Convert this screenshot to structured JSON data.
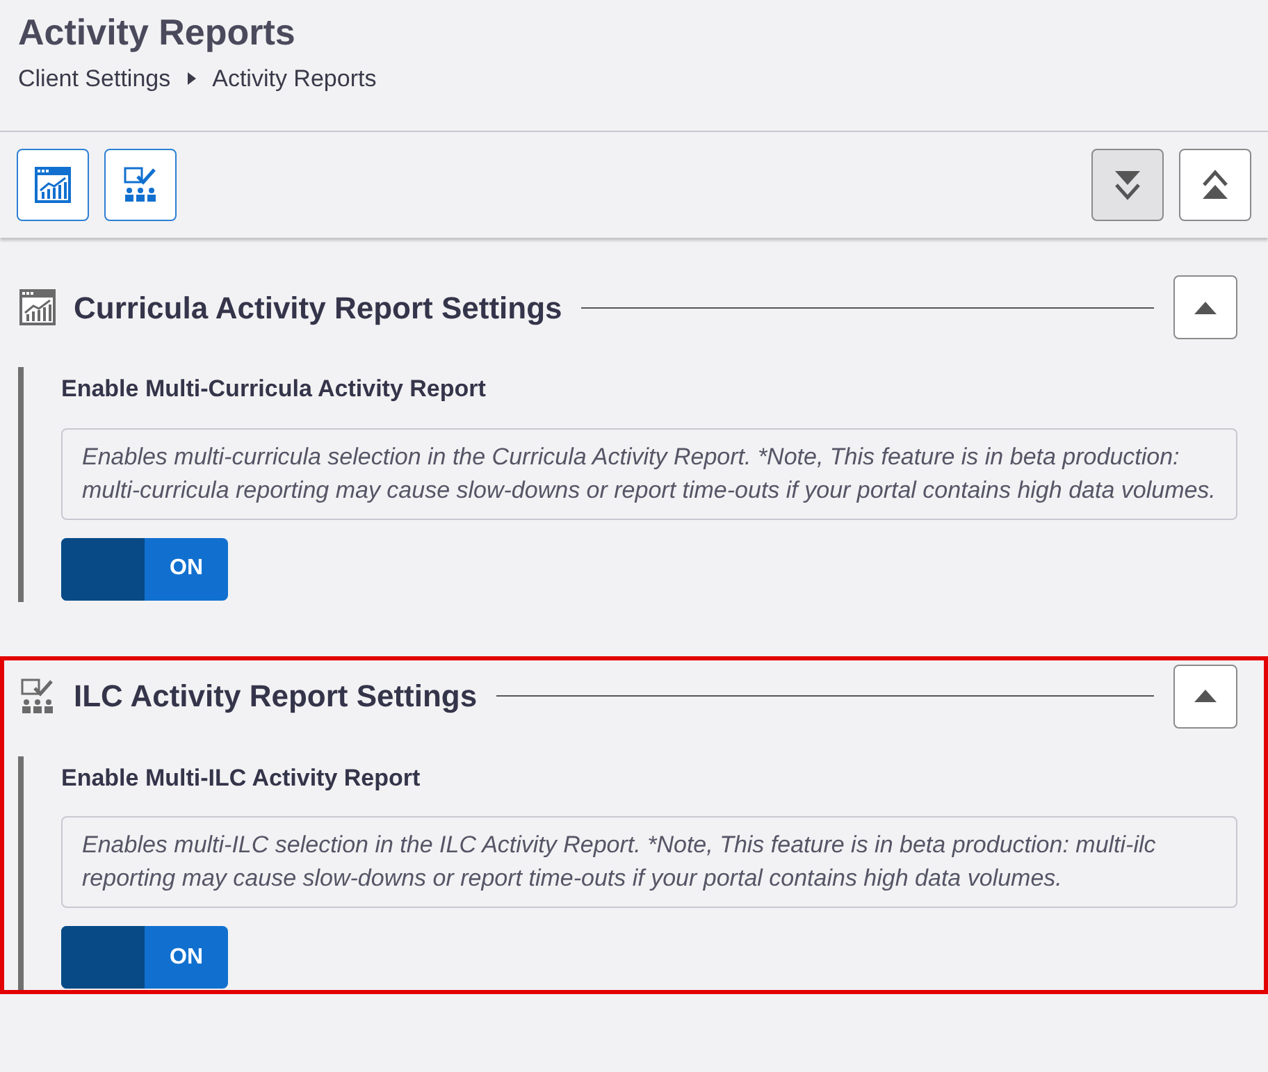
{
  "page": {
    "title": "Activity Reports",
    "breadcrumb": [
      "Client Settings",
      "Activity Reports"
    ]
  },
  "toolbar": {
    "jump_buttons": [
      {
        "kind": "chart"
      },
      {
        "kind": "ilc"
      }
    ],
    "expand_all": {
      "pressed": true
    },
    "collapse_all": {
      "pressed": false
    }
  },
  "sections": [
    {
      "kind": "chart",
      "title": "Curricula Activity Report Settings",
      "expanded": true,
      "highlighted": false,
      "settings": [
        {
          "label": "Enable Multi-Curricula Activity Report",
          "description": "Enables multi-curricula selection in the Curricula Activity Report. *Note, This feature is in beta production: multi-curricula reporting may cause slow-downs or report time-outs if your portal contains high data volumes.",
          "on": true,
          "state_label": "ON"
        }
      ]
    },
    {
      "kind": "ilc",
      "title": "ILC Activity Report Settings",
      "expanded": true,
      "highlighted": true,
      "settings": [
        {
          "label": "Enable Multi-ILC Activity Report",
          "description": "Enables multi-ILC selection in the ILC Activity Report. *Note, This feature is in beta production: multi-ilc reporting may cause slow-downs or report time-outs if your portal contains high data volumes.",
          "on": true,
          "state_label": "ON"
        }
      ]
    }
  ]
}
